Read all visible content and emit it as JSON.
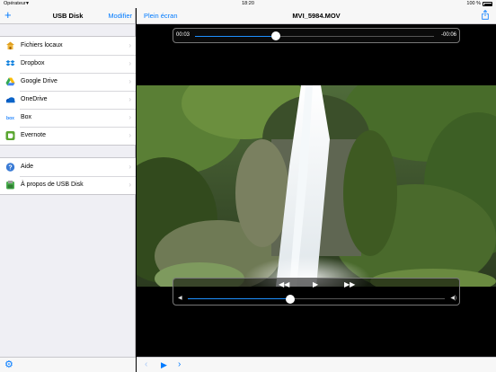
{
  "status": {
    "carrier": "Opérateur",
    "time": "18:20",
    "battery": "100 %"
  },
  "sidebar": {
    "add_icon": "+",
    "title": "USB Disk",
    "edit_label": "Modifier",
    "storage_items": [
      {
        "label": "Fichiers locaux",
        "icon": "folder-icon"
      },
      {
        "label": "Dropbox",
        "icon": "dropbox-icon"
      },
      {
        "label": "Google Drive",
        "icon": "google-drive-icon"
      },
      {
        "label": "OneDrive",
        "icon": "onedrive-icon"
      },
      {
        "label": "Box",
        "icon": "box-icon"
      },
      {
        "label": "Evernote",
        "icon": "evernote-icon"
      }
    ],
    "info_items": [
      {
        "label": "Aide",
        "icon": "help-icon"
      },
      {
        "label": "À propos de USB Disk",
        "icon": "about-icon"
      }
    ],
    "settings_icon": "gear-icon"
  },
  "player": {
    "fullscreen_label": "Plein écran",
    "filename": "MVI_5984.MOV",
    "share_icon": "share-icon",
    "elapsed": "00:03",
    "remaining": "-00:06",
    "progress": 0.34,
    "volume": 0.4
  },
  "colors": {
    "accent": "#007aff",
    "slider_fill": "#1e90ff"
  }
}
